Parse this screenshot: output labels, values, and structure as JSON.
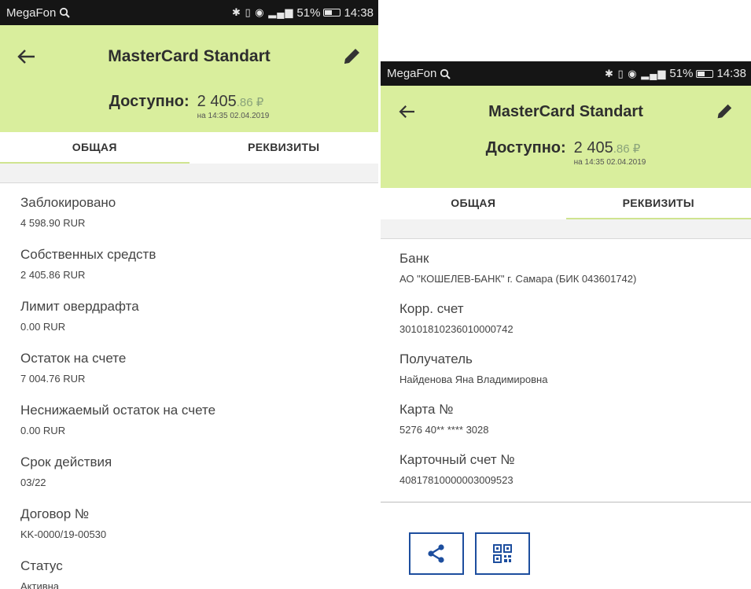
{
  "statusbar": {
    "carrier": "MegaFon",
    "battery": "51%",
    "time": "14:38",
    "network": "4G"
  },
  "header": {
    "title": "MasterCard Standart",
    "available_label": "Доступно:",
    "amount_int": "2 405",
    "amount_dec": ".86 ₽",
    "as_of": "на 14:35 02.04.2019"
  },
  "tabs": {
    "general": "ОБЩАЯ",
    "details": "РЕКВИЗИТЫ"
  },
  "general_items": [
    {
      "label": "Заблокировано",
      "value": "4 598.90 RUR"
    },
    {
      "label": "Собственных средств",
      "value": "2 405.86 RUR"
    },
    {
      "label": "Лимит овердрафта",
      "value": "0.00 RUR"
    },
    {
      "label": "Остаток на счете",
      "value": "7 004.76 RUR"
    },
    {
      "label": "Неснижаемый остаток на счете",
      "value": "0.00 RUR"
    },
    {
      "label": "Срок действия",
      "value": "03/22"
    },
    {
      "label": "Договор №",
      "value": "KK-0000/19-00530"
    },
    {
      "label": "Статус",
      "value": "Активна"
    }
  ],
  "details_items": [
    {
      "label": "Банк",
      "value": "АО \"КОШЕЛЕВ-БАНК\" г. Самара (БИК 043601742)"
    },
    {
      "label": "Корр. счет",
      "value": "30101810236010000742"
    },
    {
      "label": "Получатель",
      "value": "Найденова Яна Владимировна"
    },
    {
      "label": "Карта №",
      "value": "5276 40** **** 3028"
    },
    {
      "label": "Карточный счет №",
      "value": "40817810000003009523"
    }
  ],
  "icons": {
    "back": "arrow-left-icon",
    "edit": "pencil-icon",
    "share": "share-icon",
    "qr": "qr-code-icon"
  },
  "colors": {
    "header_bg": "#d9ee9d",
    "tab_indicator": "#cfe490",
    "button_border": "#1d4e9e",
    "statusbar_bg": "#151515"
  }
}
